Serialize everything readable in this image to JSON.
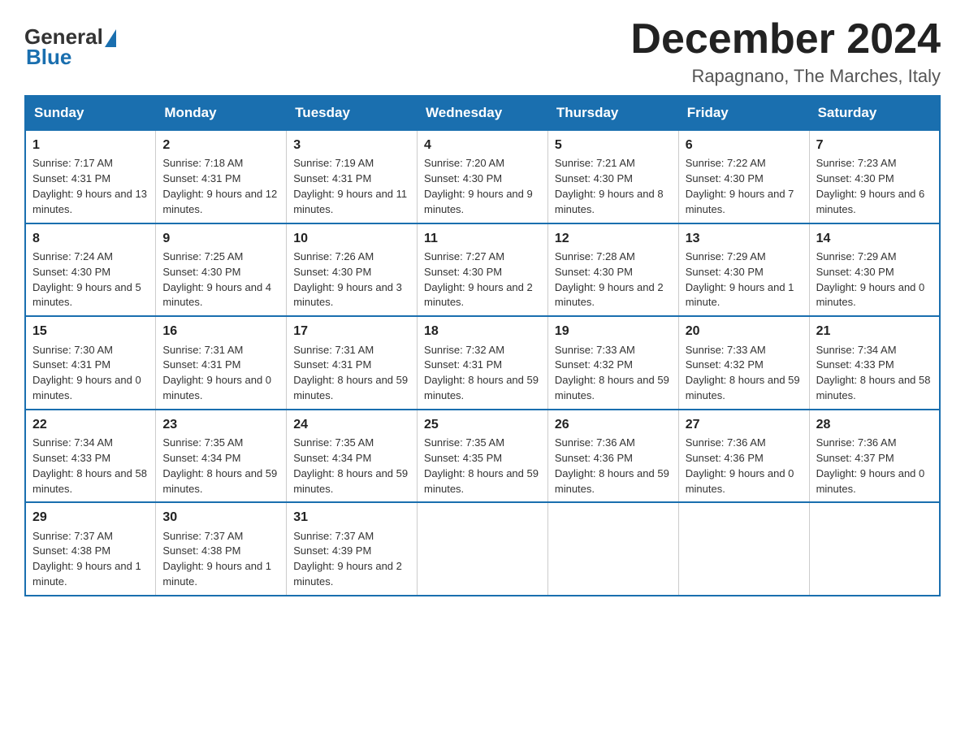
{
  "header": {
    "month_title": "December 2024",
    "location": "Rapagnano, The Marches, Italy"
  },
  "logo": {
    "general": "General",
    "blue_text": "Blue"
  },
  "days_of_week": [
    "Sunday",
    "Monday",
    "Tuesday",
    "Wednesday",
    "Thursday",
    "Friday",
    "Saturday"
  ],
  "weeks": [
    [
      {
        "day": "1",
        "sunrise": "7:17 AM",
        "sunset": "4:31 PM",
        "daylight": "9 hours and 13 minutes."
      },
      {
        "day": "2",
        "sunrise": "7:18 AM",
        "sunset": "4:31 PM",
        "daylight": "9 hours and 12 minutes."
      },
      {
        "day": "3",
        "sunrise": "7:19 AM",
        "sunset": "4:31 PM",
        "daylight": "9 hours and 11 minutes."
      },
      {
        "day": "4",
        "sunrise": "7:20 AM",
        "sunset": "4:30 PM",
        "daylight": "9 hours and 9 minutes."
      },
      {
        "day": "5",
        "sunrise": "7:21 AM",
        "sunset": "4:30 PM",
        "daylight": "9 hours and 8 minutes."
      },
      {
        "day": "6",
        "sunrise": "7:22 AM",
        "sunset": "4:30 PM",
        "daylight": "9 hours and 7 minutes."
      },
      {
        "day": "7",
        "sunrise": "7:23 AM",
        "sunset": "4:30 PM",
        "daylight": "9 hours and 6 minutes."
      }
    ],
    [
      {
        "day": "8",
        "sunrise": "7:24 AM",
        "sunset": "4:30 PM",
        "daylight": "9 hours and 5 minutes."
      },
      {
        "day": "9",
        "sunrise": "7:25 AM",
        "sunset": "4:30 PM",
        "daylight": "9 hours and 4 minutes."
      },
      {
        "day": "10",
        "sunrise": "7:26 AM",
        "sunset": "4:30 PM",
        "daylight": "9 hours and 3 minutes."
      },
      {
        "day": "11",
        "sunrise": "7:27 AM",
        "sunset": "4:30 PM",
        "daylight": "9 hours and 2 minutes."
      },
      {
        "day": "12",
        "sunrise": "7:28 AM",
        "sunset": "4:30 PM",
        "daylight": "9 hours and 2 minutes."
      },
      {
        "day": "13",
        "sunrise": "7:29 AM",
        "sunset": "4:30 PM",
        "daylight": "9 hours and 1 minute."
      },
      {
        "day": "14",
        "sunrise": "7:29 AM",
        "sunset": "4:30 PM",
        "daylight": "9 hours and 0 minutes."
      }
    ],
    [
      {
        "day": "15",
        "sunrise": "7:30 AM",
        "sunset": "4:31 PM",
        "daylight": "9 hours and 0 minutes."
      },
      {
        "day": "16",
        "sunrise": "7:31 AM",
        "sunset": "4:31 PM",
        "daylight": "9 hours and 0 minutes."
      },
      {
        "day": "17",
        "sunrise": "7:31 AM",
        "sunset": "4:31 PM",
        "daylight": "8 hours and 59 minutes."
      },
      {
        "day": "18",
        "sunrise": "7:32 AM",
        "sunset": "4:31 PM",
        "daylight": "8 hours and 59 minutes."
      },
      {
        "day": "19",
        "sunrise": "7:33 AM",
        "sunset": "4:32 PM",
        "daylight": "8 hours and 59 minutes."
      },
      {
        "day": "20",
        "sunrise": "7:33 AM",
        "sunset": "4:32 PM",
        "daylight": "8 hours and 59 minutes."
      },
      {
        "day": "21",
        "sunrise": "7:34 AM",
        "sunset": "4:33 PM",
        "daylight": "8 hours and 58 minutes."
      }
    ],
    [
      {
        "day": "22",
        "sunrise": "7:34 AM",
        "sunset": "4:33 PM",
        "daylight": "8 hours and 58 minutes."
      },
      {
        "day": "23",
        "sunrise": "7:35 AM",
        "sunset": "4:34 PM",
        "daylight": "8 hours and 59 minutes."
      },
      {
        "day": "24",
        "sunrise": "7:35 AM",
        "sunset": "4:34 PM",
        "daylight": "8 hours and 59 minutes."
      },
      {
        "day": "25",
        "sunrise": "7:35 AM",
        "sunset": "4:35 PM",
        "daylight": "8 hours and 59 minutes."
      },
      {
        "day": "26",
        "sunrise": "7:36 AM",
        "sunset": "4:36 PM",
        "daylight": "8 hours and 59 minutes."
      },
      {
        "day": "27",
        "sunrise": "7:36 AM",
        "sunset": "4:36 PM",
        "daylight": "9 hours and 0 minutes."
      },
      {
        "day": "28",
        "sunrise": "7:36 AM",
        "sunset": "4:37 PM",
        "daylight": "9 hours and 0 minutes."
      }
    ],
    [
      {
        "day": "29",
        "sunrise": "7:37 AM",
        "sunset": "4:38 PM",
        "daylight": "9 hours and 1 minute."
      },
      {
        "day": "30",
        "sunrise": "7:37 AM",
        "sunset": "4:38 PM",
        "daylight": "9 hours and 1 minute."
      },
      {
        "day": "31",
        "sunrise": "7:37 AM",
        "sunset": "4:39 PM",
        "daylight": "9 hours and 2 minutes."
      },
      null,
      null,
      null,
      null
    ]
  ]
}
